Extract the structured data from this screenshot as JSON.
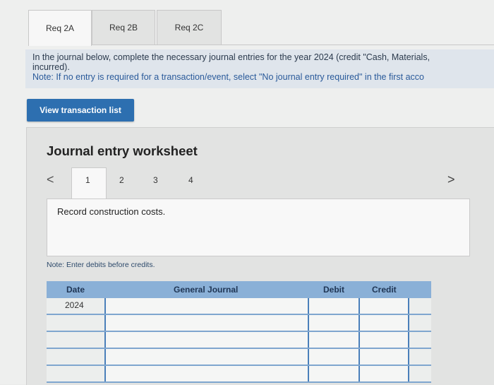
{
  "tabs": [
    {
      "label": "Req 2A"
    },
    {
      "label": "Req 2B"
    },
    {
      "label": "Req 2C"
    }
  ],
  "instructions": {
    "line1": "In the journal below, complete the necessary journal entries for the year 2024 (credit \"Cash, Materials,",
    "line2": "incurred).",
    "note": "Note: If no entry is required for a transaction/event, select \"No journal entry required\" in the first acco"
  },
  "view_button": "View transaction list",
  "worksheet": {
    "title": "Journal entry worksheet",
    "prev": "<",
    "next": ">",
    "steps": [
      "1",
      "2",
      "3",
      "4"
    ],
    "description": "Record construction costs.",
    "note": "Note: Enter debits before credits.",
    "columns": {
      "date": "Date",
      "journal": "General Journal",
      "debit": "Debit",
      "credit": "Credit"
    },
    "rows": [
      {
        "date": "2024"
      },
      {
        "date": ""
      },
      {
        "date": ""
      },
      {
        "date": ""
      },
      {
        "date": ""
      }
    ]
  }
}
